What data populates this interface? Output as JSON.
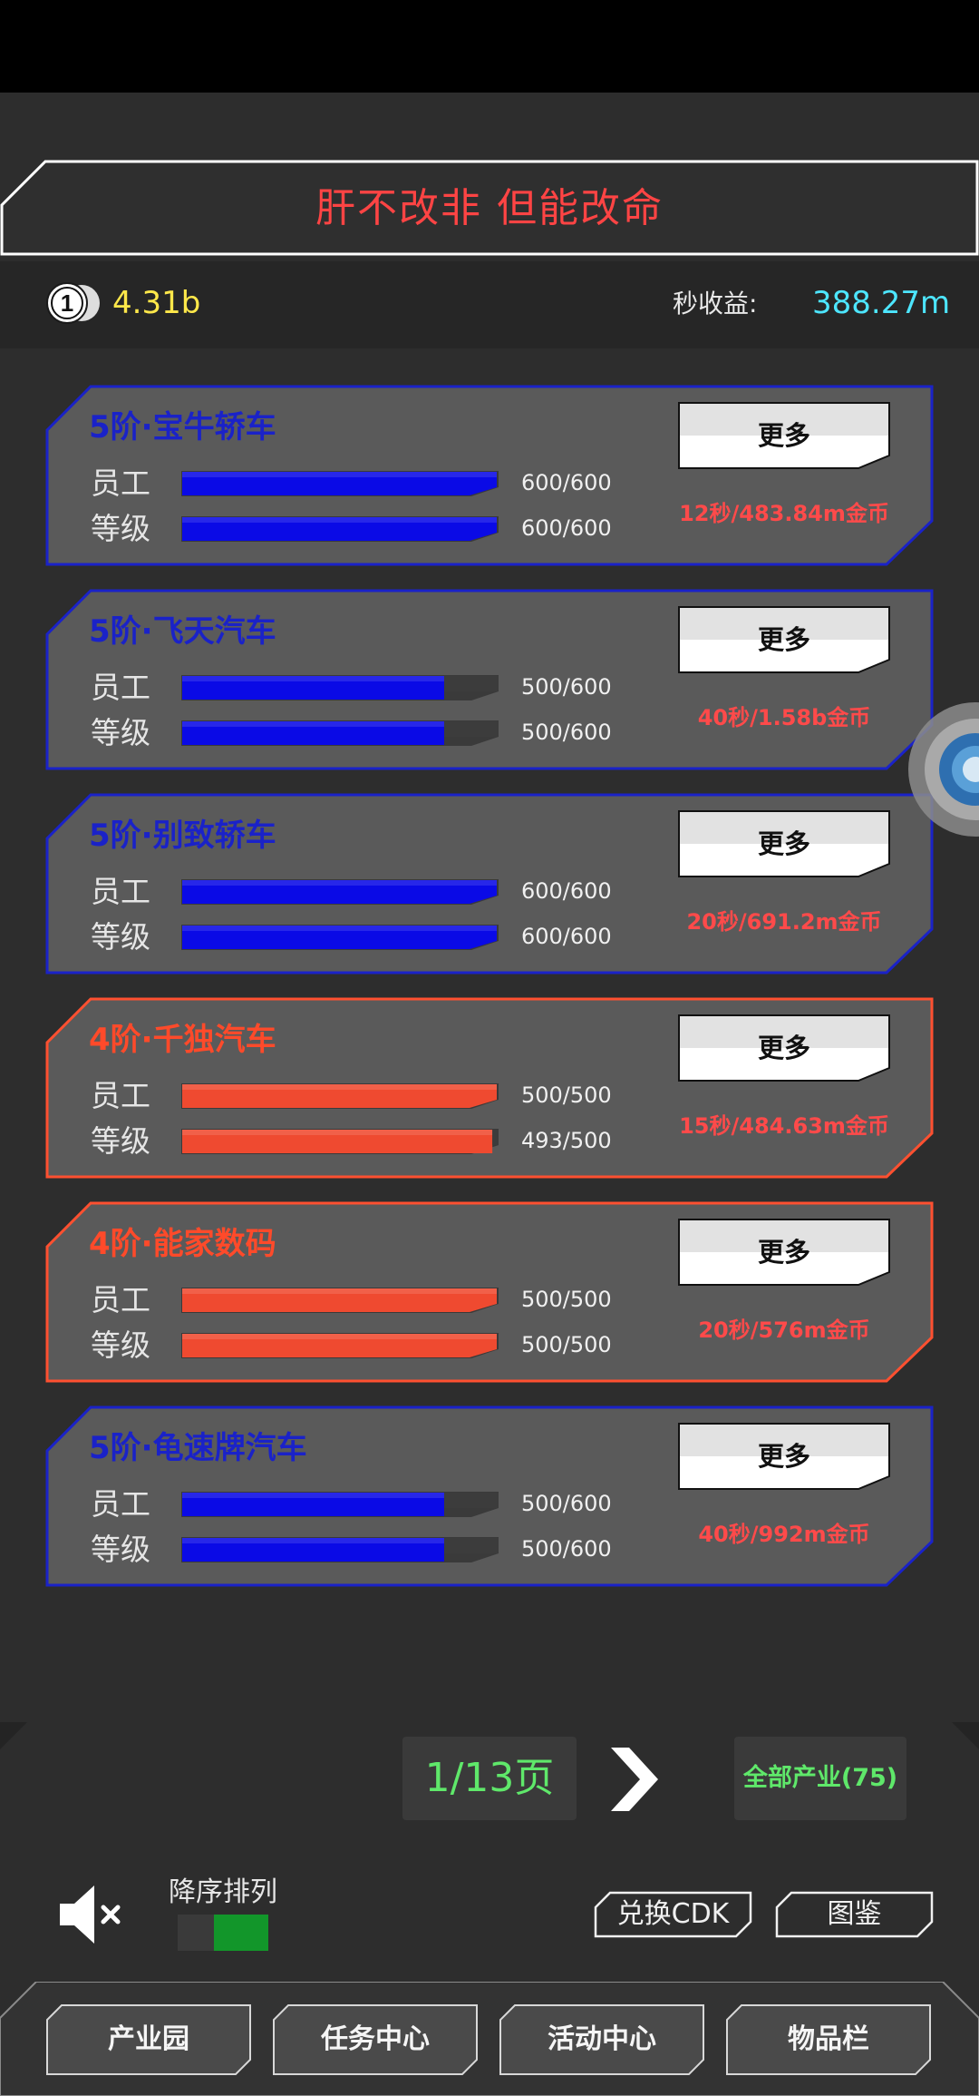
{
  "banner": {
    "title": "肝不改非 但能改命"
  },
  "currency": {
    "coin_icon": "coin-1-icon",
    "amount": "4.31b",
    "income_label": "秒收益:",
    "income_value": "388.27m"
  },
  "cards": [
    {
      "title": "5阶·宝牛轿车",
      "theme": "blue",
      "staff_label": "员工",
      "level_label": "等级",
      "staff_value": "600/600",
      "staff_fraction": 1.0,
      "level_value": "600/600",
      "level_fraction": 1.0,
      "more_label": "更多",
      "rate": "12秒/483.84m金币"
    },
    {
      "title": "5阶·飞天汽车",
      "theme": "blue",
      "staff_label": "员工",
      "level_label": "等级",
      "staff_value": "500/600",
      "staff_fraction": 0.8333,
      "level_value": "500/600",
      "level_fraction": 0.8333,
      "more_label": "更多",
      "rate": "40秒/1.58b金币"
    },
    {
      "title": "5阶·别致轿车",
      "theme": "blue",
      "staff_label": "员工",
      "level_label": "等级",
      "staff_value": "600/600",
      "staff_fraction": 1.0,
      "level_value": "600/600",
      "level_fraction": 1.0,
      "more_label": "更多",
      "rate": "20秒/691.2m金币"
    },
    {
      "title": "4阶·千独汽车",
      "theme": "red",
      "staff_label": "员工",
      "level_label": "等级",
      "staff_value": "500/500",
      "staff_fraction": 1.0,
      "level_value": "493/500",
      "level_fraction": 0.986,
      "more_label": "更多",
      "rate": "15秒/484.63m金币"
    },
    {
      "title": "4阶·能家数码",
      "theme": "red",
      "staff_label": "员工",
      "level_label": "等级",
      "staff_value": "500/500",
      "staff_fraction": 1.0,
      "level_value": "500/500",
      "level_fraction": 1.0,
      "more_label": "更多",
      "rate": "20秒/576m金币"
    },
    {
      "title": "5阶·龟速牌汽车",
      "theme": "blue",
      "staff_label": "员工",
      "level_label": "等级",
      "staff_value": "500/600",
      "staff_fraction": 0.8333,
      "level_value": "500/600",
      "level_fraction": 0.8333,
      "more_label": "更多",
      "rate": "40秒/992m金币"
    }
  ],
  "pagination": {
    "page": "1/13页",
    "next_icon": "chevron-right-icon",
    "all_label": "全部产业(75)"
  },
  "controls": {
    "mute_icon": "speaker-muted-icon",
    "sort_label": "降序排列",
    "sort_on": true,
    "cdk_label": "兑换CDK",
    "codex_label": "图鉴"
  },
  "nav": {
    "tabs": [
      "产业园",
      "任务中心",
      "活动中心",
      "物品栏"
    ]
  },
  "colors": {
    "blue_frame": "#1a22c8",
    "blue_fill": "#0a0ae6",
    "red_frame": "#ff5030",
    "red_fill": "#ef4a30",
    "card_bg": "#5a5a5a",
    "accent_green": "#5fe86a",
    "income_cyan": "#4de6ff",
    "coin_yellow": "#ffe84a",
    "title_red": "#ff4444"
  }
}
